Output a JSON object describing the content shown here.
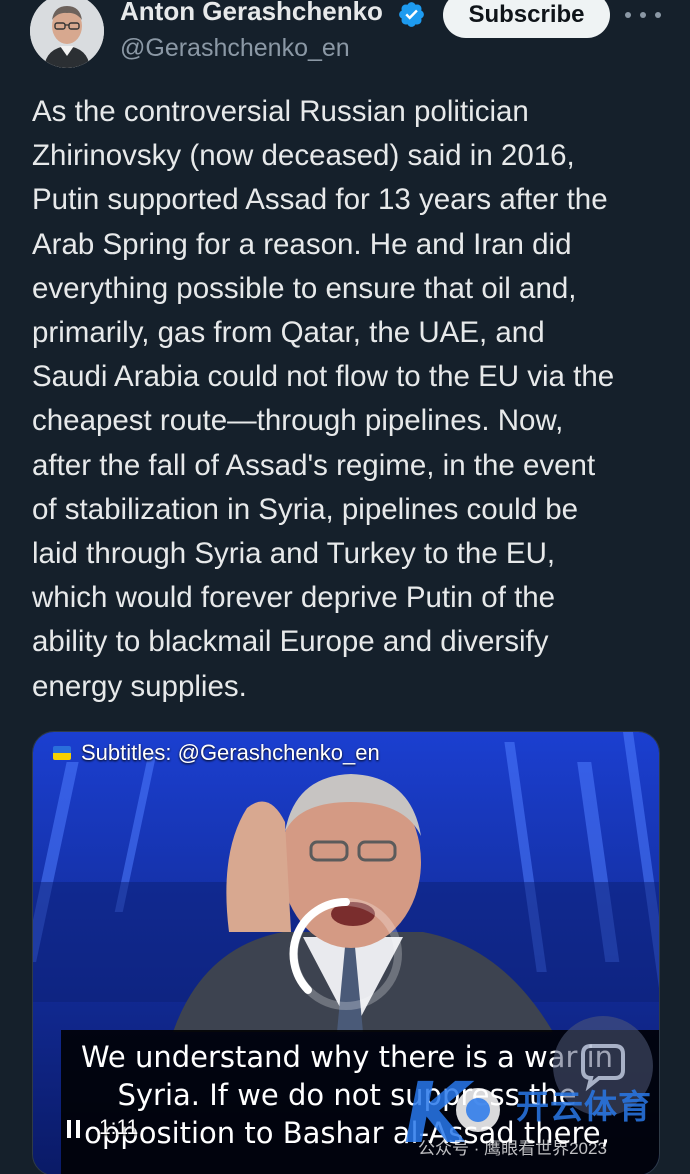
{
  "author": {
    "name": "Anton Gerashchenko",
    "handle": "@Gerashchenko_en",
    "verified_icon": "verified-badge-icon",
    "verified_color": "#1d9bf0"
  },
  "actions": {
    "subscribe_label": "Subscribe",
    "more_icon": "more-options-icon"
  },
  "tweet": {
    "lines": [
      "As the controversial Russian politician",
      "Zhirinovsky (now deceased) said in 2016,",
      "Putin supported Assad for 13 years after the",
      "Arab Spring for a reason. He and Iran did",
      "everything possible to ensure that oil and,",
      "primarily, gas from Qatar, the UAE, and",
      "Saudi Arabia could not flow to the EU via the",
      "cheapest route—through pipelines. Now,",
      "after the fall of Assad's regime, in the event",
      "of stabilization in Syria, pipelines could be",
      "laid through Syria and Turkey to the EU,",
      "which would forever deprive Putin of the",
      "ability to blackmail Europe and diversify",
      "energy supplies."
    ]
  },
  "video": {
    "subtitle_credit": "Subtitles: @Gerashchenko_en",
    "caption_lines": [
      "We understand why there is a war in",
      "Syria. If we do not suppress the",
      "opposition to Bashar al-Assad there,"
    ],
    "elapsed_time": "1:11",
    "pause_icon": "pause-icon",
    "loading_icon": "loading-spinner-icon"
  },
  "watermark": {
    "brand_text": "开云体育",
    "logo_letters": "K",
    "caption": "公众号 · 鹰眼看世界2023",
    "bubble_icon": "chat-bubble-icon"
  },
  "colors": {
    "background": "#15202b",
    "subscribe_bg": "#eff3f4",
    "secondary_text": "#8b98a5"
  }
}
